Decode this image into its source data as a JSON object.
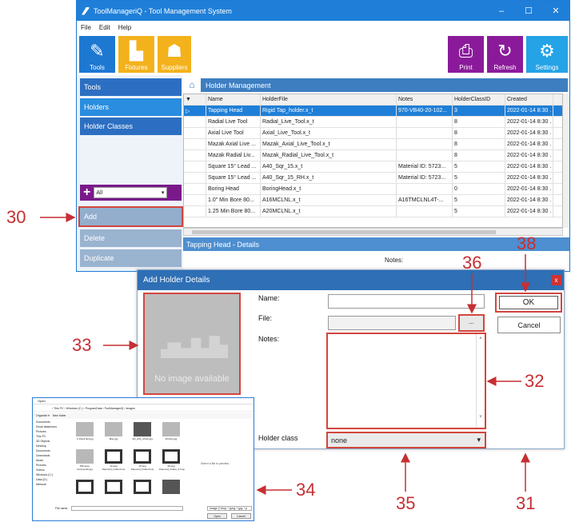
{
  "window": {
    "title": "ToolManageriQ - Tool Management System",
    "controls": [
      "–",
      "☐",
      "✕"
    ]
  },
  "menu": [
    "File",
    "Edit",
    "Help"
  ],
  "ribbon": {
    "tools": "Tools",
    "fixtures": "Fixtures",
    "suppliers": "Suppliers",
    "print": "Print",
    "refresh": "Refresh",
    "settings": "Settings"
  },
  "sidebar": {
    "tools": "Tools",
    "holders": "Holders",
    "holder_classes": "Holder Classes",
    "filter_value": "All",
    "add": "Add",
    "delete": "Delete",
    "duplicate": "Duplicate"
  },
  "main": {
    "header": "Holder Management",
    "details_header": "Tapping Head - Details",
    "notes_label": "Notes:"
  },
  "grid": {
    "columns": [
      "Name",
      "HolderFile",
      "Notes",
      "HolderClassID",
      "Created"
    ],
    "rows": [
      [
        "Tapping Head",
        "Rigid Tap_holder.x_t",
        "970-VB40-20-102...",
        "3",
        "2022-01-14 8:30 ."
      ],
      [
        "Radial Live Tool",
        "Radial_Live_Tool.x_t",
        "",
        "8",
        "2022-01-14 8:30 ."
      ],
      [
        "Axial Live Tool",
        "Axial_Live_Tool.x_t",
        "",
        "8",
        "2022-01-14 8:30 ."
      ],
      [
        "Mazak Axial Live ...",
        "Mazak_Axial_Live_Tool.x_t",
        "",
        "8",
        "2022-01-14 8:30 ."
      ],
      [
        "Mazak Radial Liv...",
        "Mazak_Radial_Live_Tool.x_t",
        "",
        "8",
        "2022-01-14 8:30 ."
      ],
      [
        "Square 15° Lead ...",
        "A40_Sqr_15.x_t",
        "Material ID: 5723...",
        "5",
        "2022-01-14 8:30 ."
      ],
      [
        "Square 15° Lead ...",
        "A40_Sqr_15_RH.x_t",
        "Material ID: 5723...",
        "5",
        "2022-01-14 8:30 ."
      ],
      [
        "Boring Head",
        "BoringHead.x_t",
        "",
        "0",
        "2022-01-14 8:30 ."
      ],
      [
        "1.0\" Min Bore 80...",
        "A16MCLNL.x_t",
        "A16TMCLNL4T-...",
        "5",
        "2022-01-14 8:30 ."
      ],
      [
        "1.25 Min Bore 80...",
        "A20MCLNL.x_t",
        "",
        "5",
        "2022-01-14 8:30 ."
      ]
    ]
  },
  "dialog": {
    "title": "Add Holder Details",
    "close": "x",
    "no_image": "No image available",
    "name_label": "Name:",
    "file_label": "File:",
    "notes_label": "Notes:",
    "holder_class_label": "Holder class",
    "browse": "...",
    "ok": "OK",
    "cancel": "Cancel",
    "holder_class_value": "none"
  },
  "file_dialog": {
    "title": "Open",
    "path": "› This PC › Windows (C:) › ProgramData › ToolManageriQ › Images",
    "search": "Search Images",
    "organize": "Organize ▾",
    "new_folder": "New folder",
    "tree": [
      "Documents",
      "Email attachmen",
      "Pictures",
      "This PC",
      "3D Objects",
      "Desktop",
      "Documents",
      "Downloads",
      "Music",
      "Pictures",
      "Videos",
      "Windows (C:)",
      "Data (D:)",
      "Network"
    ],
    "files": [
      "-2 Pluck Ref.jpg",
      "Max.jpg",
      "4th_with_chuck.jpg",
      "4thAxis.jpg",
      "T86 auto-hcuteverbit.jpg",
      "12 deg Diamond_holder.bmp",
      "15 deg Diamond_holder.bmp",
      "35 deg Diamond_holder_2.bmp"
    ],
    "preview_text": "Select a file to preview.",
    "file_name_label": "File name:",
    "file_type": "Image (*.bmp; *.jpeg; *.jpg; *.p",
    "open": "Open",
    "cancel": "Cancel"
  },
  "callouts": [
    "30",
    "33",
    "34",
    "36",
    "38",
    "32",
    "35",
    "31"
  ],
  "colors": {
    "accent": "#1f7fd8",
    "callout": "#c62f33",
    "purple": "#8b1a9b",
    "orange": "#f3b21c"
  }
}
